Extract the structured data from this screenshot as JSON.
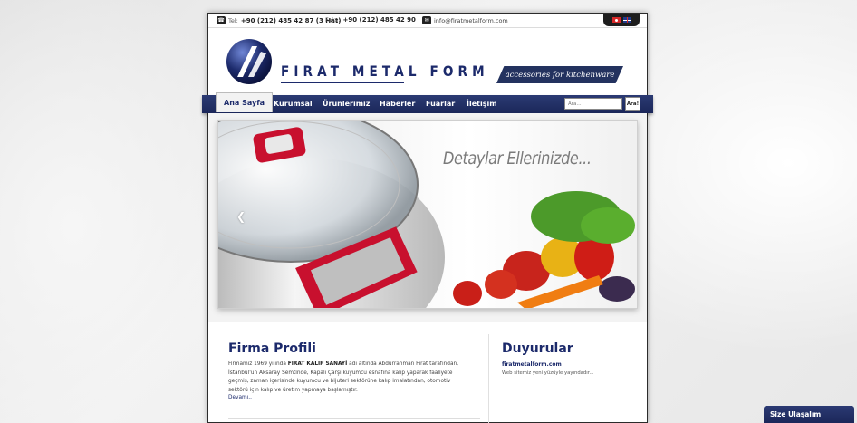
{
  "topbar": {
    "tel_label": "Tel:",
    "tel_number": "+90 (212) 485 42 87 (3 Hat)",
    "fax_label": "Faks:",
    "fax_number": "+90 (212) 485 42 90",
    "email": "info@firatmetalform.com",
    "languages": [
      "tr",
      "en"
    ]
  },
  "header": {
    "logo_text": "FIRAT METAL FORM",
    "tagline": "accessories for kitchenware"
  },
  "nav": {
    "items": [
      {
        "label": "Ana Sayfa",
        "active": true
      },
      {
        "label": "Kurumsal"
      },
      {
        "label": "Ürünlerimiz"
      },
      {
        "label": "Haberler"
      },
      {
        "label": "Fuarlar"
      },
      {
        "label": "İletişim"
      }
    ],
    "search_placeholder": "Ara...",
    "search_button": "Ara!"
  },
  "slider": {
    "headline": "Detaylar Ellerinizde..."
  },
  "profile": {
    "title": "Firma Profili",
    "text_before": "Firmamız 1969 yılında ",
    "text_bold": "FIRAT KALIP SANAYİ",
    "text_after": " adı altında Abdurrahman Fırat tarafından, İstanbul'un Aksaray Semtinde, Kapalı Çarşı kuyumcu esnafına kalıp yaparak faaliyete geçmiş, zaman içerisinde kuyumcu ve bijuteri sektörüne kalıp imalatından, otomotiv sektörü için kalıp ve üretim yapmaya başlamıştır.",
    "more": "Devamı.."
  },
  "news": {
    "title": "Duyurular",
    "headline": "firatmetalform.com",
    "body": "Web sitemiz yeni yüzüyle yayındadır..."
  },
  "contact_tab": "Size Ulaşalım",
  "colors": {
    "brand_navy": "#1c2a6b",
    "nav_bg": "#23325f",
    "accent_red": "#c8102e"
  }
}
